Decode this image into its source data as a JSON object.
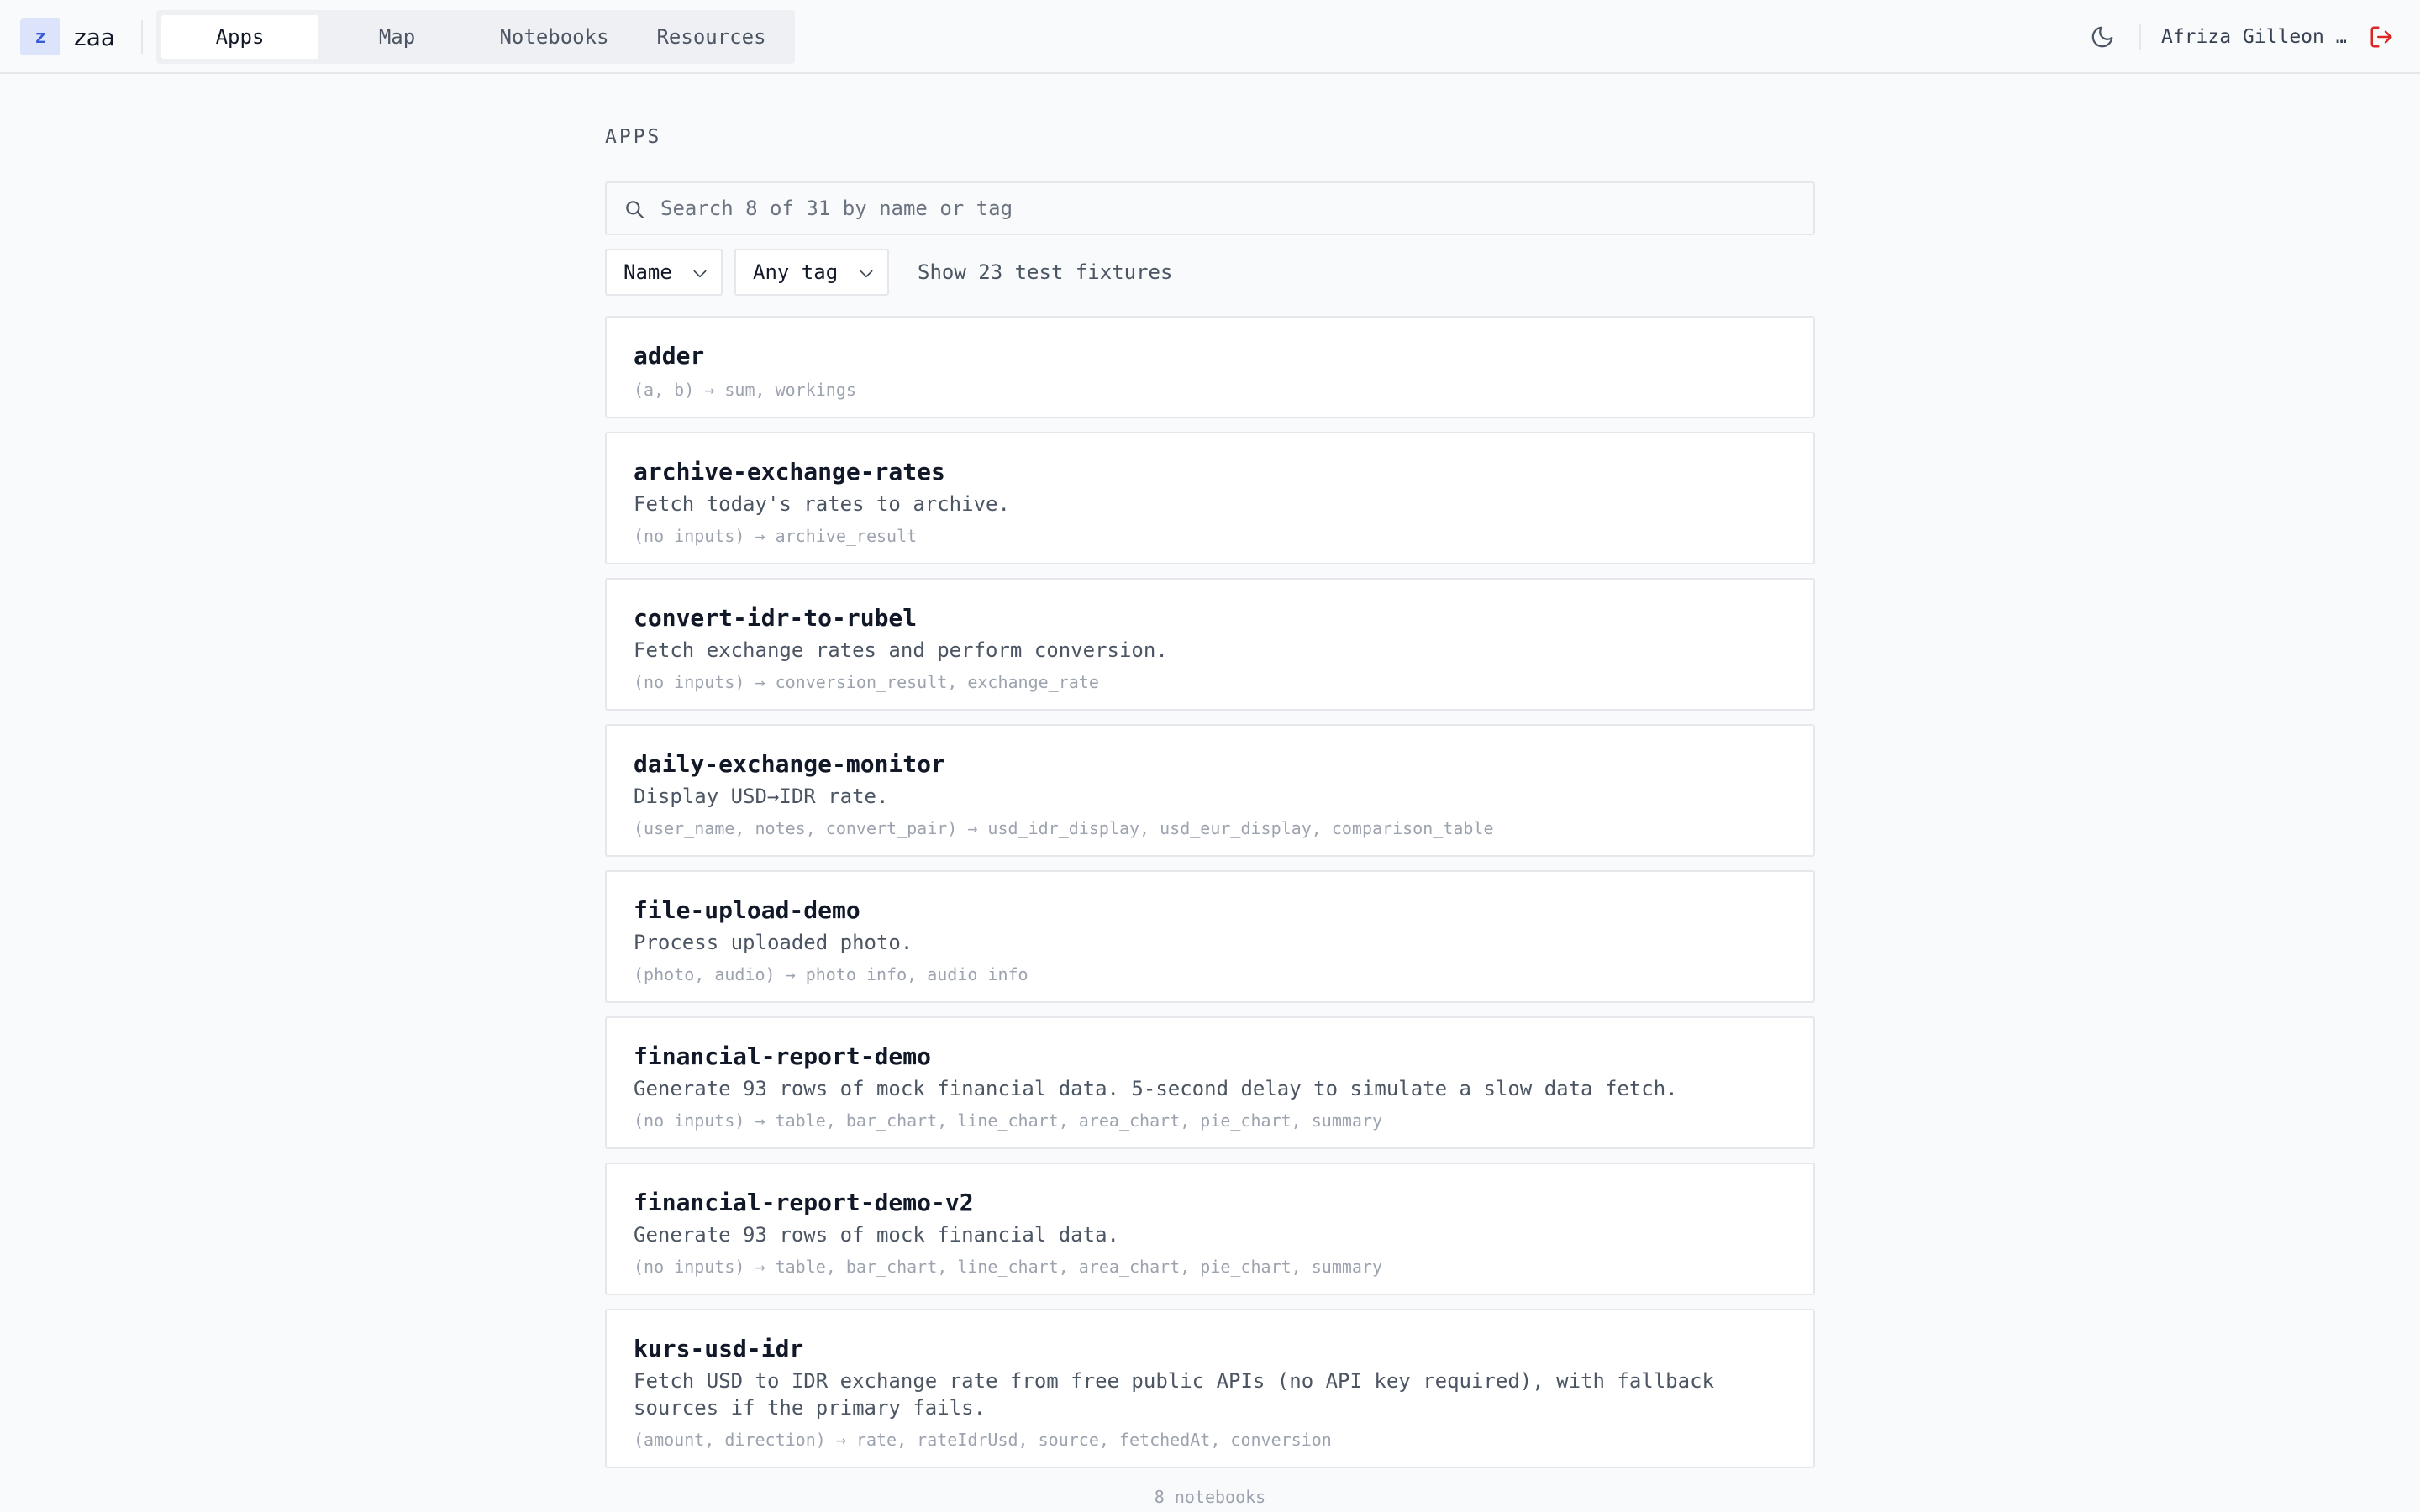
{
  "header": {
    "logo_letter": "z",
    "brand": "zaa",
    "tabs": [
      {
        "label": "Apps",
        "active": true
      },
      {
        "label": "Map",
        "active": false
      },
      {
        "label": "Notebooks",
        "active": false
      },
      {
        "label": "Resources",
        "active": false
      }
    ],
    "theme_icon": "moon-icon",
    "user_name": "Afriza Gilleon …",
    "logout_icon": "logout-icon"
  },
  "main": {
    "section_title": "APPS",
    "search": {
      "placeholder": "Search 8 of 31 by name or tag",
      "value": ""
    },
    "sort_select": {
      "value": "Name"
    },
    "tag_select": {
      "value": "Any tag"
    },
    "fixtures_toggle": "Show 23 test fixtures",
    "apps": [
      {
        "name": "adder",
        "description": "",
        "signature": "(a, b) → sum, workings"
      },
      {
        "name": "archive-exchange-rates",
        "description": "Fetch today's rates to archive.",
        "signature": "(no inputs) → archive_result"
      },
      {
        "name": "convert-idr-to-rubel",
        "description": "Fetch exchange rates and perform conversion.",
        "signature": "(no inputs) → conversion_result, exchange_rate"
      },
      {
        "name": "daily-exchange-monitor",
        "description": "Display USD→IDR rate.",
        "signature": "(user_name, notes, convert_pair) → usd_idr_display, usd_eur_display, comparison_table"
      },
      {
        "name": "file-upload-demo",
        "description": "Process uploaded photo.",
        "signature": "(photo, audio) → photo_info, audio_info"
      },
      {
        "name": "financial-report-demo",
        "description": "Generate 93 rows of mock financial data. 5-second delay to simulate a slow data fetch.",
        "signature": "(no inputs) → table, bar_chart, line_chart, area_chart, pie_chart, summary"
      },
      {
        "name": "financial-report-demo-v2",
        "description": "Generate 93 rows of mock financial data.",
        "signature": "(no inputs) → table, bar_chart, line_chart, area_chart, pie_chart, summary"
      },
      {
        "name": "kurs-usd-idr",
        "description": "Fetch USD to IDR exchange rate from free public APIs (no API key required), with fallback sources if the primary fails.",
        "signature": "(amount, direction) → rate, rateIdrUsd, source, fetchedAt, conversion"
      }
    ],
    "footer_count": "8 notebooks"
  },
  "colors": {
    "accent_bg": "#dbe4fb",
    "accent_text": "#3b5bd6",
    "logout": "#dc2626"
  }
}
